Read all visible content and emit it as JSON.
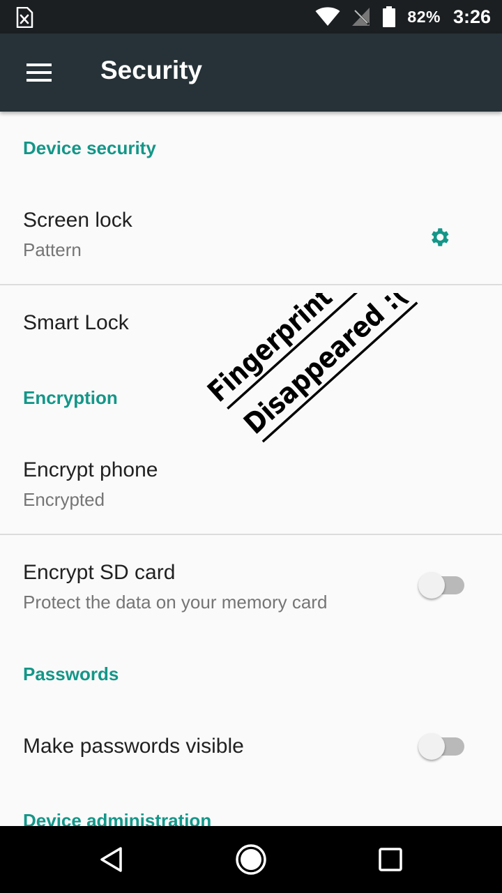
{
  "status_bar": {
    "left_icon": "sim-error-icon",
    "wifi_icon": "wifi-icon",
    "signal_icon": "no-signal-icon",
    "battery_icon": "battery-icon",
    "battery": "82%",
    "time": "3:26"
  },
  "app_bar": {
    "menu_icon": "hamburger-menu-icon",
    "title": "Security"
  },
  "sections": {
    "device_security": {
      "header": "Device security",
      "screen_lock": {
        "title": "Screen lock",
        "summary": "Pattern",
        "settings_icon": "gear-icon"
      },
      "smart_lock": {
        "title": "Smart Lock"
      }
    },
    "encryption": {
      "header": "Encryption",
      "encrypt_phone": {
        "title": "Encrypt phone",
        "summary": "Encrypted"
      },
      "encrypt_sd": {
        "title": "Encrypt SD card",
        "summary": "Protect the data on your memory card",
        "enabled": false
      }
    },
    "passwords": {
      "header": "Passwords",
      "visible_passwords": {
        "title": "Make passwords visible",
        "enabled": false
      }
    },
    "device_administration": {
      "header": "Device administration"
    }
  },
  "annotation": {
    "line1": "Fingerprint Option",
    "line2": "Disappeared :("
  },
  "nav_bar": {
    "back_icon": "back-icon",
    "home_icon": "home-icon",
    "recents_icon": "recents-icon"
  },
  "colors": {
    "accent": "#149688",
    "app_bar": "#263238",
    "status_bar": "#1b1f22",
    "background": "#fafafa"
  }
}
